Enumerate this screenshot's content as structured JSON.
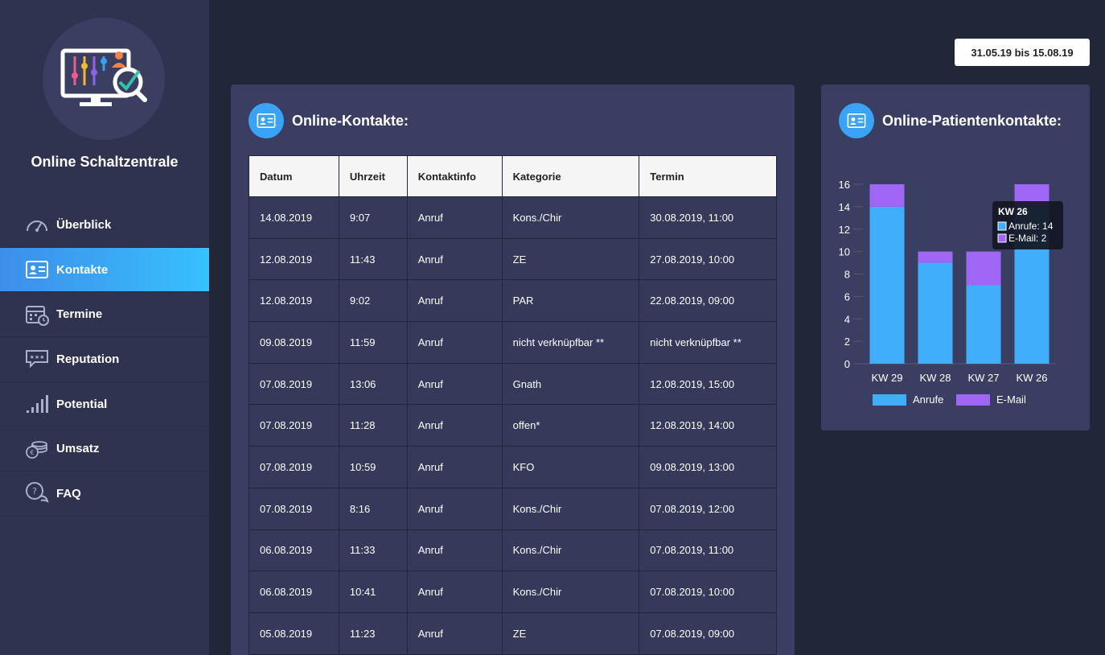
{
  "sidebar": {
    "app_title": "Online Schaltzentrale",
    "items": [
      {
        "label": "Überblick",
        "icon": "speedometer-icon"
      },
      {
        "label": "Kontakte",
        "icon": "contact-card-icon",
        "active": true
      },
      {
        "label": "Termine",
        "icon": "calendar-icon"
      },
      {
        "label": "Reputation",
        "icon": "review-bubble-icon"
      },
      {
        "label": "Potential",
        "icon": "signal-bars-icon"
      },
      {
        "label": "Umsatz",
        "icon": "coins-icon"
      },
      {
        "label": "FAQ",
        "icon": "question-bubble-icon"
      }
    ]
  },
  "date_range": "31.05.19 bis 15.08.19",
  "contacts": {
    "title": "Online-Kontakte:",
    "columns": [
      "Datum",
      "Uhrzeit",
      "Kontaktinfo",
      "Kategorie",
      "Termin"
    ],
    "rows": [
      [
        "14.08.2019",
        "9:07",
        "Anruf",
        "Kons./Chir",
        "30.08.2019, 11:00"
      ],
      [
        "12.08.2019",
        "11:43",
        "Anruf",
        "ZE",
        "27.08.2019, 10:00"
      ],
      [
        "12.08.2019",
        "9:02",
        "Anruf",
        "PAR",
        "22.08.2019, 09:00"
      ],
      [
        "09.08.2019",
        "11:59",
        "Anruf",
        "nicht verknüpfbar **",
        "nicht verknüpfbar **"
      ],
      [
        "07.08.2019",
        "13:06",
        "Anruf",
        "Gnath",
        "12.08.2019, 15:00"
      ],
      [
        "07.08.2019",
        "11:28",
        "Anruf",
        "offen*",
        "12.08.2019, 14:00"
      ],
      [
        "07.08.2019",
        "10:59",
        "Anruf",
        "KFO",
        "09.08.2019, 13:00"
      ],
      [
        "07.08.2019",
        "8:16",
        "Anruf",
        "Kons./Chir",
        "07.08.2019, 12:00"
      ],
      [
        "06.08.2019",
        "11:33",
        "Anruf",
        "Kons./Chir",
        "07.08.2019, 11:00"
      ],
      [
        "06.08.2019",
        "10:41",
        "Anruf",
        "Kons./Chir",
        "07.08.2019, 10:00"
      ],
      [
        "05.08.2019",
        "11:23",
        "Anruf",
        "ZE",
        "07.08.2019, 09:00"
      ]
    ]
  },
  "patient_chart": {
    "title": "Online-Patientenkontakte:",
    "tooltip": {
      "title": "KW 26",
      "lines": [
        "Anrufe: 14",
        "E-Mail: 2"
      ]
    }
  },
  "chart_data": {
    "type": "bar",
    "stacked": true,
    "categories": [
      "KW 29",
      "KW 28",
      "KW 27",
      "KW 26"
    ],
    "series": [
      {
        "name": "Anrufe",
        "values": [
          14,
          9,
          7,
          14
        ],
        "color": "#41aefc"
      },
      {
        "name": "E-Mail",
        "values": [
          2,
          1,
          3,
          2
        ],
        "color": "#a066f5"
      }
    ],
    "ylim": [
      0,
      16
    ],
    "yticks": [
      0,
      2,
      4,
      6,
      8,
      10,
      12,
      14,
      16
    ],
    "legend": "bottom",
    "title": "",
    "xlabel": "",
    "ylabel": ""
  }
}
